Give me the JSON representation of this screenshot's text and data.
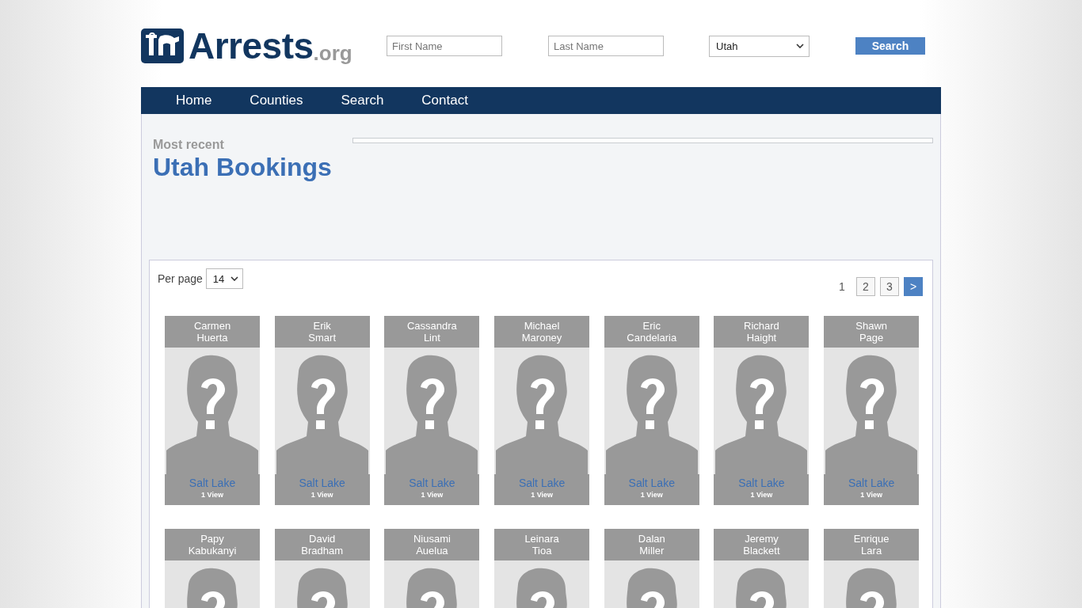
{
  "logo": {
    "name": "Arrests",
    "suffix": ".org"
  },
  "search": {
    "first_name": {
      "placeholder": "First Name"
    },
    "last_name": {
      "placeholder": "Last Name"
    },
    "state": "Utah",
    "button": "Search"
  },
  "nav": [
    "Home",
    "Counties",
    "Search",
    "Contact"
  ],
  "heading": {
    "kicker": "Most recent",
    "title": "Utah Bookings"
  },
  "per_page": {
    "label": "Per page",
    "value": "14"
  },
  "pages": [
    {
      "label": "1",
      "selected": true
    },
    {
      "label": "2",
      "selected": false
    },
    {
      "label": "3",
      "selected": false
    },
    {
      "label": ">",
      "selected": false,
      "kind": "next"
    }
  ],
  "cards": [
    {
      "first": "Carmen",
      "last": "Huerta",
      "county": "Salt Lake",
      "views": "1 View"
    },
    {
      "first": "Erik",
      "last": "Smart",
      "county": "Salt Lake",
      "views": "1 View"
    },
    {
      "first": "Cassandra",
      "last": "Lint",
      "county": "Salt Lake",
      "views": "1 View"
    },
    {
      "first": "Michael",
      "last": "Maroney",
      "county": "Salt Lake",
      "views": "1 View"
    },
    {
      "first": "Eric",
      "last": "Candelaria",
      "county": "Salt Lake",
      "views": "1 View"
    },
    {
      "first": "Richard",
      "last": "Haight",
      "county": "Salt Lake",
      "views": "1 View"
    },
    {
      "first": "Shawn",
      "last": "Page",
      "county": "Salt Lake",
      "views": "1 View"
    },
    {
      "first": "Papy",
      "last": "Kabukanyi"
    },
    {
      "first": "David",
      "last": "Bradham"
    },
    {
      "first": "Niusami",
      "last": "Auelua"
    },
    {
      "first": "Leinara",
      "last": "Tioa"
    },
    {
      "first": "Dalan",
      "last": "Miller"
    },
    {
      "first": "Jeremy",
      "last": "Blackett"
    },
    {
      "first": "Enrique",
      "last": "Lara"
    }
  ]
}
